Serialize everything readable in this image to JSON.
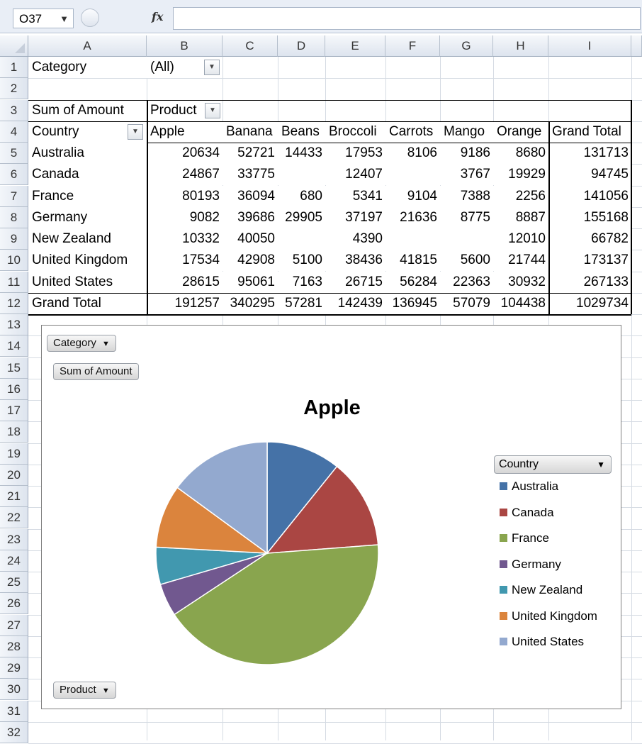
{
  "formula_bar": {
    "name_box": "O37",
    "formula": ""
  },
  "columns": [
    "A",
    "B",
    "C",
    "D",
    "E",
    "F",
    "G",
    "H",
    "I"
  ],
  "rows": [
    "1",
    "2",
    "3",
    "4",
    "5",
    "6",
    "7",
    "8",
    "9",
    "10",
    "11",
    "12",
    "13",
    "14",
    "15",
    "16",
    "17",
    "18",
    "19",
    "20",
    "21",
    "22",
    "23",
    "24",
    "25",
    "26",
    "27",
    "28",
    "29",
    "30",
    "31",
    "32"
  ],
  "pivot": {
    "filter_label": "Category",
    "filter_value": "(All)",
    "values_label": "Sum of Amount",
    "col_field": "Product",
    "row_field": "Country",
    "headers": [
      "Apple",
      "Banana",
      "Beans",
      "Broccoli",
      "Carrots",
      "Mango",
      "Orange",
      "Grand Total"
    ],
    "rows": [
      {
        "label": "Australia",
        "values": [
          "20634",
          "52721",
          "14433",
          "17953",
          "8106",
          "9186",
          "8680",
          "131713"
        ]
      },
      {
        "label": "Canada",
        "values": [
          "24867",
          "33775",
          "",
          "12407",
          "",
          "3767",
          "19929",
          "94745"
        ]
      },
      {
        "label": "France",
        "values": [
          "80193",
          "36094",
          "680",
          "5341",
          "9104",
          "7388",
          "2256",
          "141056"
        ]
      },
      {
        "label": "Germany",
        "values": [
          "9082",
          "39686",
          "29905",
          "37197",
          "21636",
          "8775",
          "8887",
          "155168"
        ]
      },
      {
        "label": "New Zealand",
        "values": [
          "10332",
          "40050",
          "",
          "4390",
          "",
          "",
          "12010",
          "66782"
        ]
      },
      {
        "label": "United Kingdom",
        "values": [
          "17534",
          "42908",
          "5100",
          "38436",
          "41815",
          "5600",
          "21744",
          "173137"
        ]
      },
      {
        "label": "United States",
        "values": [
          "28615",
          "95061",
          "7163",
          "26715",
          "56284",
          "22363",
          "30932",
          "267133"
        ]
      }
    ],
    "total_row": {
      "label": "Grand Total",
      "values": [
        "191257",
        "340295",
        "57281",
        "142439",
        "136945",
        "57079",
        "104438",
        "1029734"
      ]
    }
  },
  "chart": {
    "filter_button": "Category",
    "values_button": "Sum of Amount",
    "axis_button": "Product",
    "legend_button": "Country"
  },
  "chart_data": {
    "type": "pie",
    "title": "Apple",
    "categories": [
      "Australia",
      "Canada",
      "France",
      "Germany",
      "New Zealand",
      "United Kingdom",
      "United States"
    ],
    "values": [
      20634,
      24867,
      80193,
      9082,
      10332,
      17534,
      28615
    ],
    "colors": [
      "#4572a7",
      "#aa4643",
      "#89a54e",
      "#71588f",
      "#4198af",
      "#db843d",
      "#93a9cf"
    ],
    "legend_position": "right"
  }
}
